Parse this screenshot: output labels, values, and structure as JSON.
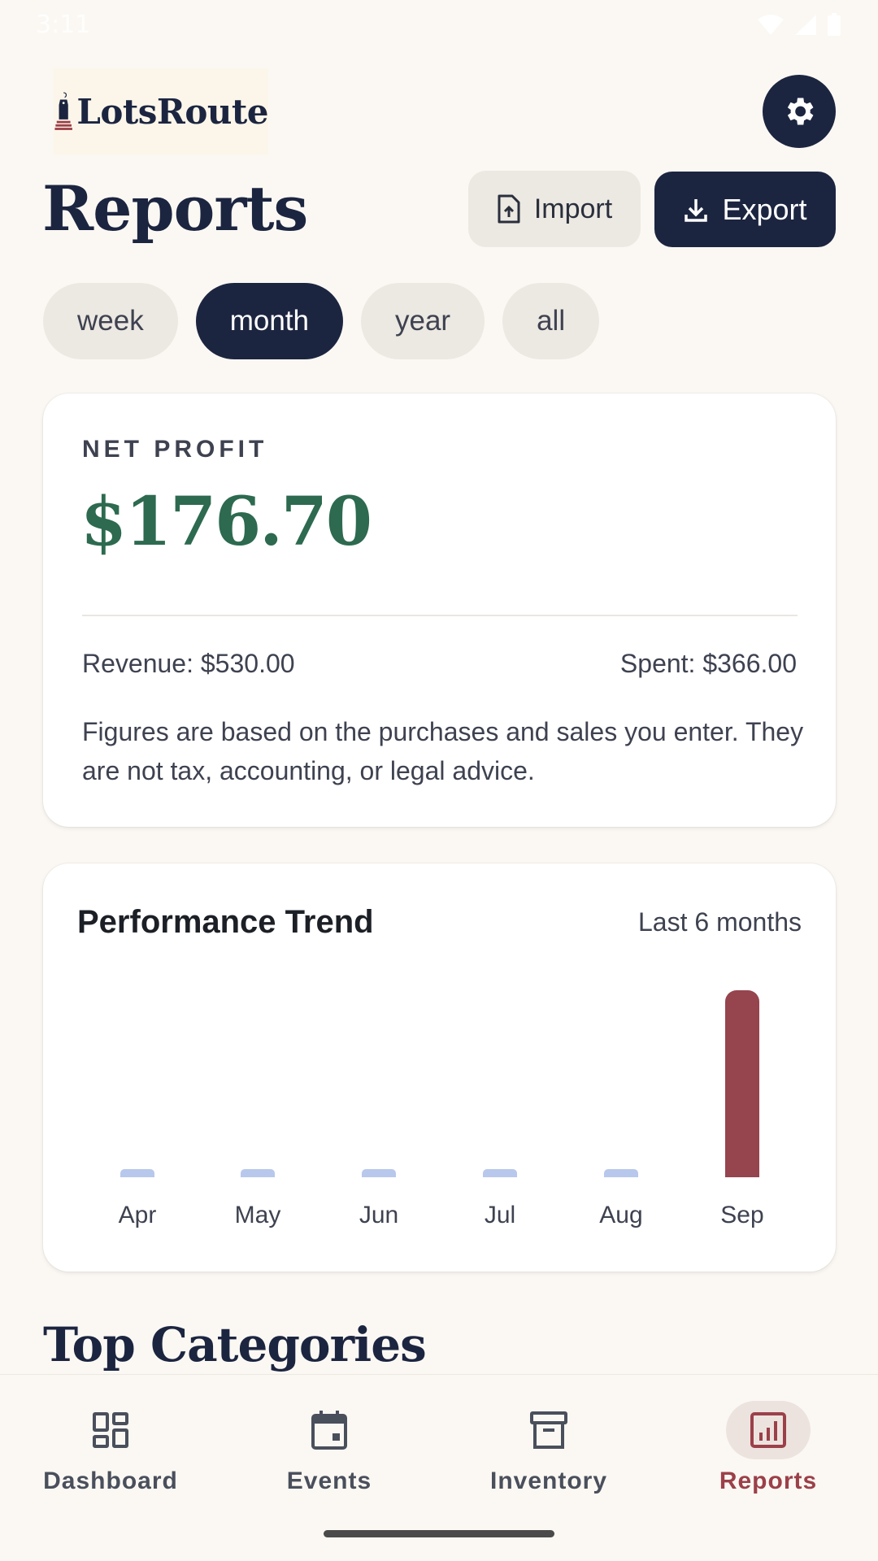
{
  "status_bar": {
    "time": "3:11"
  },
  "app": {
    "logo_text": "LotsRoute"
  },
  "header": {
    "title": "Reports",
    "import_label": "Import",
    "export_label": "Export"
  },
  "filters": [
    {
      "label": "week",
      "active": false
    },
    {
      "label": "month",
      "active": true
    },
    {
      "label": "year",
      "active": false
    },
    {
      "label": "all",
      "active": false
    }
  ],
  "profit": {
    "label": "NET PROFIT",
    "value": "$176.70",
    "revenue": "Revenue: $530.00",
    "spent": "Spent: $366.00",
    "disclaimer": "Figures are based on the purchases and sales you enter. They are not tax, accounting, or legal advice."
  },
  "trend": {
    "title": "Performance Trend",
    "range": "Last 6 months"
  },
  "chart_data": {
    "type": "bar",
    "categories": [
      "Apr",
      "May",
      "Jun",
      "Jul",
      "Aug",
      "Sep"
    ],
    "values": [
      0,
      0,
      0,
      0,
      0,
      176.7
    ],
    "title": "Performance Trend",
    "xlabel": "",
    "ylabel": "",
    "colors": {
      "empty": "#b8c8ec",
      "positive": "#96444e"
    }
  },
  "sections": {
    "top_categories": "Top Categories"
  },
  "nav": [
    {
      "label": "Dashboard",
      "icon": "dashboard-icon",
      "active": false
    },
    {
      "label": "Events",
      "icon": "calendar-icon",
      "active": false
    },
    {
      "label": "Inventory",
      "icon": "archive-icon",
      "active": false
    },
    {
      "label": "Reports",
      "icon": "chart-icon",
      "active": true
    }
  ]
}
